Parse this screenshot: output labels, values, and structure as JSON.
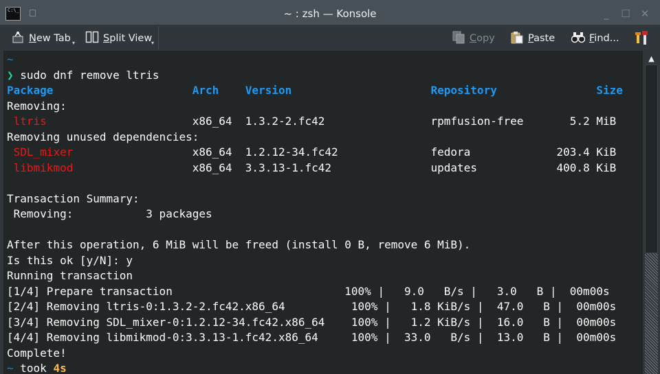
{
  "window": {
    "title": "~ : zsh — Konsole",
    "app_icon_text": "C:\\_"
  },
  "titlebar_buttons": [
    {
      "name": "minimize-icon",
      "glyph": "_"
    },
    {
      "name": "maximize-icon",
      "glyph": "☐"
    },
    {
      "name": "close-icon",
      "glyph": "✕"
    }
  ],
  "toolbar": {
    "new_tab": {
      "label": "New Tab",
      "mnemonic": "N",
      "icon": "new-tab-icon"
    },
    "split_view": {
      "label": "Split View",
      "mnemonic": "S",
      "icon": "split-view-icon"
    },
    "copy": {
      "label": "Copy",
      "mnemonic": "C",
      "icon": "copy-icon",
      "enabled": false
    },
    "paste": {
      "label": "Paste",
      "mnemonic": "P",
      "icon": "paste-icon"
    },
    "find": {
      "label": "Find...",
      "mnemonic": "F",
      "icon": "binoculars-icon"
    },
    "menu": {
      "icon": "hamburger-menu-icon"
    }
  },
  "colors": {
    "terminal_bg": "#232627",
    "text": "#fcfcfc",
    "header_blue": "#1d99f3",
    "package_red": "#ed1515",
    "prompt_green": "#1cdc9a",
    "cwd_dim": "#2980b9",
    "took_yellow": "#fdbc4b"
  },
  "terminal": {
    "lines": [
      {
        "segments": [
          {
            "text": "~",
            "color": "cwd_dim"
          }
        ]
      },
      {
        "segments": [
          {
            "text": "❯",
            "color": "prompt_green"
          },
          {
            "text": " sudo dnf remove ltris",
            "color": "text"
          }
        ]
      },
      {
        "segments": [
          {
            "text": "Package                     ",
            "color": "header_blue",
            "bold": true
          },
          {
            "text": "Arch    ",
            "color": "header_blue",
            "bold": true
          },
          {
            "text": "Version                     ",
            "color": "header_blue",
            "bold": true
          },
          {
            "text": "Repository               ",
            "color": "header_blue",
            "bold": true
          },
          {
            "text": "Size",
            "color": "header_blue",
            "bold": true
          }
        ]
      },
      {
        "segments": [
          {
            "text": "Removing:",
            "color": "text"
          }
        ]
      },
      {
        "segments": [
          {
            "text": " ",
            "color": "text"
          },
          {
            "text": "ltris",
            "color": "package_red"
          },
          {
            "text": "                      x86_64  1.3.2-2.fc42                rpmfusion-free       5.2 MiB",
            "color": "text"
          }
        ]
      },
      {
        "segments": [
          {
            "text": "Removing unused dependencies:",
            "color": "text"
          }
        ]
      },
      {
        "segments": [
          {
            "text": " ",
            "color": "text"
          },
          {
            "text": "SDL_mixer",
            "color": "package_red"
          },
          {
            "text": "                  x86_64  1.2.12-34.fc42              fedora             203.4 KiB",
            "color": "text"
          }
        ]
      },
      {
        "segments": [
          {
            "text": " ",
            "color": "text"
          },
          {
            "text": "libmikmod",
            "color": "package_red"
          },
          {
            "text": "                  x86_64  3.3.13-1.fc42               updates            400.8 KiB",
            "color": "text"
          }
        ]
      },
      {
        "segments": [
          {
            "text": "",
            "color": "text"
          }
        ]
      },
      {
        "segments": [
          {
            "text": "Transaction Summary:",
            "color": "text"
          }
        ]
      },
      {
        "segments": [
          {
            "text": " Removing:           3 packages",
            "color": "text"
          }
        ]
      },
      {
        "segments": [
          {
            "text": "",
            "color": "text"
          }
        ]
      },
      {
        "segments": [
          {
            "text": "After this operation, 6 MiB will be freed (install 0 B, remove 6 MiB).",
            "color": "text"
          }
        ]
      },
      {
        "segments": [
          {
            "text": "Is this ok [y/N]: y",
            "color": "text"
          }
        ]
      },
      {
        "segments": [
          {
            "text": "Running transaction",
            "color": "text"
          }
        ]
      },
      {
        "segments": [
          {
            "text": "[1/4] Prepare transaction                          100% |   9.0   B/s |   3.0   B |  00m00s",
            "color": "text"
          }
        ]
      },
      {
        "segments": [
          {
            "text": "[2/4] Removing ltris-0:1.3.2-2.fc42.x86_64          100% |   1.8 KiB/s |  47.0   B |  00m00s",
            "color": "text"
          }
        ]
      },
      {
        "segments": [
          {
            "text": "[3/4] Removing SDL_mixer-0:1.2.12-34.fc42.x86_64    100% |   1.2 KiB/s |  16.0   B |  00m00s",
            "color": "text"
          }
        ]
      },
      {
        "segments": [
          {
            "text": "[4/4] Removing libmikmod-0:3.3.13-1.fc42.x86_64     100% |  33.0   B/s |  13.0   B |  00m00s",
            "color": "text"
          }
        ]
      },
      {
        "segments": [
          {
            "text": "Complete!",
            "color": "text"
          }
        ]
      },
      {
        "segments": [
          {
            "text": "~",
            "color": "cwd_dim"
          },
          {
            "text": " took ",
            "color": "text"
          },
          {
            "text": "4s",
            "color": "took_yellow",
            "bold": true
          }
        ]
      }
    ]
  },
  "scrollbar": {
    "up_arrow_icon": "scroll-up-arrow-icon"
  }
}
